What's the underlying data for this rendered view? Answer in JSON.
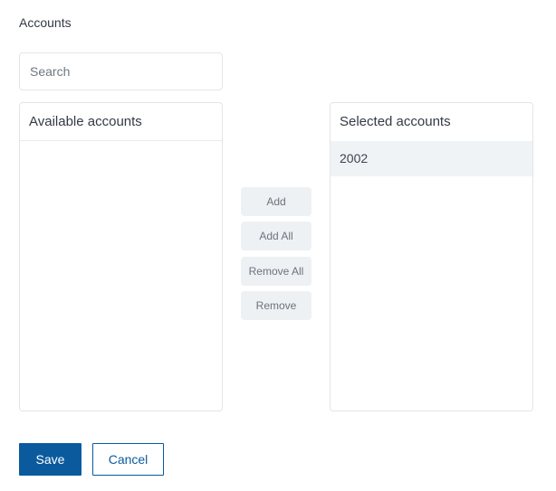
{
  "section": {
    "label": "Accounts"
  },
  "search": {
    "placeholder": "Search",
    "value": ""
  },
  "available_panel": {
    "title": "Available accounts",
    "items": []
  },
  "selected_panel": {
    "title": "Selected accounts",
    "items": [
      "2002"
    ]
  },
  "move_buttons": {
    "add": "Add",
    "add_all": "Add All",
    "remove_all": "Remove All",
    "remove": "Remove"
  },
  "actions": {
    "save": "Save",
    "cancel": "Cancel"
  },
  "colors": {
    "primary": "#0b5a9e",
    "selected_item_bg": "#f0f3f6",
    "move_button_bg": "#eef1f4",
    "border": "#e2e5e9"
  }
}
